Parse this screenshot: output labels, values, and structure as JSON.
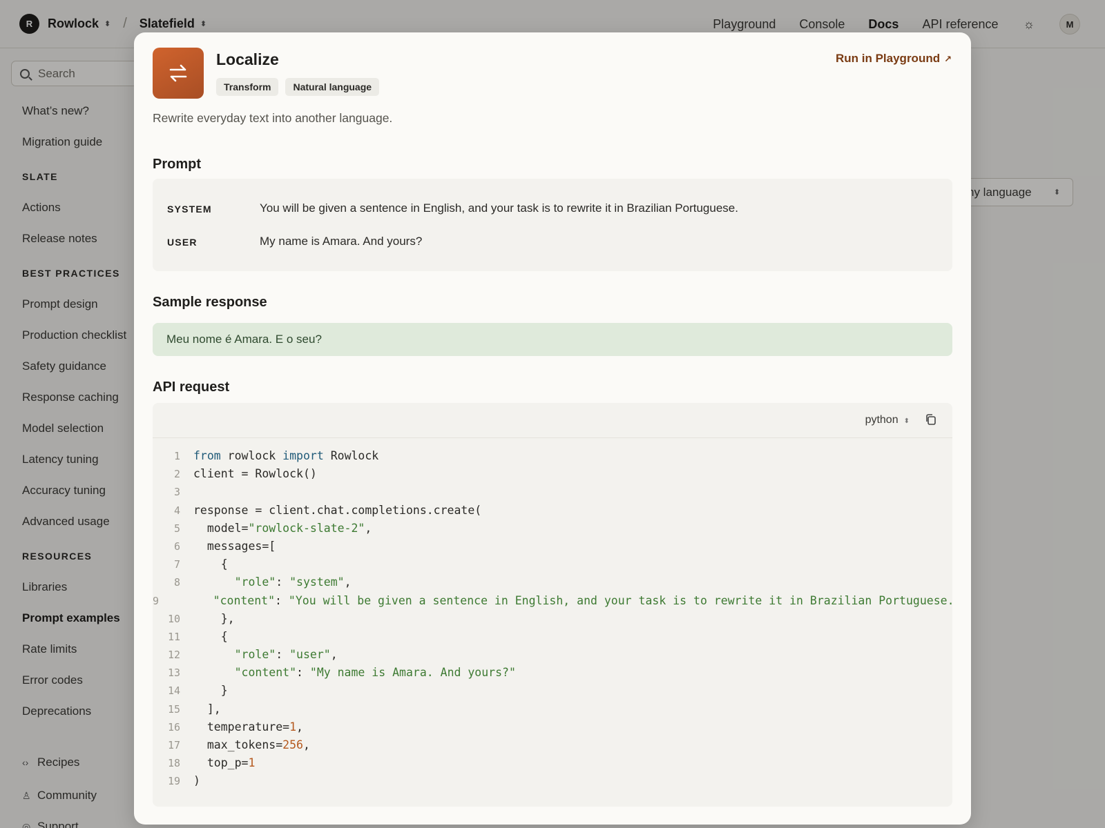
{
  "topbar": {
    "org_initial": "R",
    "org_name": "Rowlock",
    "project_name": "Slatefield",
    "nav": [
      "Playground",
      "Console",
      "Docs",
      "API reference"
    ],
    "active_nav": "Docs",
    "avatar_initial": "M"
  },
  "sidebar": {
    "search_placeholder": "Search",
    "top_items": [
      "What’s new?",
      "Migration guide"
    ],
    "sections": [
      {
        "heading": "SLATE",
        "items": [
          "Actions",
          "Release notes"
        ]
      },
      {
        "heading": "BEST PRACTICES",
        "items": [
          "Prompt design",
          "Production checklist",
          "Safety guidance",
          "Response caching",
          "Model selection",
          "Latency tuning",
          "Accuracy tuning",
          "Advanced usage"
        ]
      },
      {
        "heading": "RESOURCES",
        "items": [
          "Libraries",
          "Prompt examples",
          "Rate limits",
          "Error codes",
          "Deprecations"
        ]
      }
    ],
    "active_item": "Prompt examples",
    "footer_items": [
      "Recipes",
      "Community",
      "Support"
    ]
  },
  "background": {
    "language_select": "ny language"
  },
  "modal": {
    "title": "Localize",
    "tags": [
      "Transform",
      "Natural language"
    ],
    "run_link": "Run in Playground",
    "description": "Rewrite everyday text into another language.",
    "prompt_heading": "Prompt",
    "prompt": {
      "system_label": "SYSTEM",
      "system_text": "You will be given a sentence in English, and your task is to rewrite it in Brazilian Portuguese.",
      "user_label": "USER",
      "user_text": "My name is Amara. And yours?"
    },
    "sample_heading": "Sample response",
    "sample_response": "Meu nome é Amara. E o seu?",
    "api_heading": "API request",
    "code_language": "python",
    "code_lines": [
      [
        [
          "kw",
          "from"
        ],
        [
          "t",
          " rowlock "
        ],
        [
          "kw",
          "import"
        ],
        [
          "t",
          " Rowlock"
        ]
      ],
      [
        [
          "t",
          "client = Rowlock()"
        ]
      ],
      [
        [
          "t",
          ""
        ]
      ],
      [
        [
          "t",
          "response = client.chat.completions.create("
        ]
      ],
      [
        [
          "t",
          "  model="
        ],
        [
          "str",
          "\"rowlock-slate-2\""
        ],
        [
          "t",
          ","
        ]
      ],
      [
        [
          "t",
          "  messages=["
        ]
      ],
      [
        [
          "t",
          "    {"
        ]
      ],
      [
        [
          "t",
          "      "
        ],
        [
          "str",
          "\"role\""
        ],
        [
          "t",
          ": "
        ],
        [
          "str",
          "\"system\""
        ],
        [
          "t",
          ","
        ]
      ],
      [
        [
          "t",
          "      "
        ],
        [
          "str",
          "\"content\""
        ],
        [
          "t",
          ": "
        ],
        [
          "str",
          "\"You will be given a sentence in English, and your task is to rewrite it in Brazilian Portuguese.\""
        ]
      ],
      [
        [
          "t",
          "    },"
        ]
      ],
      [
        [
          "t",
          "    {"
        ]
      ],
      [
        [
          "t",
          "      "
        ],
        [
          "str",
          "\"role\""
        ],
        [
          "t",
          ": "
        ],
        [
          "str",
          "\"user\""
        ],
        [
          "t",
          ","
        ]
      ],
      [
        [
          "t",
          "      "
        ],
        [
          "str",
          "\"content\""
        ],
        [
          "t",
          ": "
        ],
        [
          "str",
          "\"My name is Amara. And yours?\""
        ]
      ],
      [
        [
          "t",
          "    }"
        ]
      ],
      [
        [
          "t",
          "  ],"
        ]
      ],
      [
        [
          "t",
          "  temperature="
        ],
        [
          "num",
          "1"
        ],
        [
          "t",
          ","
        ]
      ],
      [
        [
          "t",
          "  max_tokens="
        ],
        [
          "num",
          "256"
        ],
        [
          "t",
          ","
        ]
      ],
      [
        [
          "t",
          "  top_p="
        ],
        [
          "num",
          "1"
        ]
      ],
      [
        [
          "t",
          ")"
        ]
      ]
    ]
  }
}
